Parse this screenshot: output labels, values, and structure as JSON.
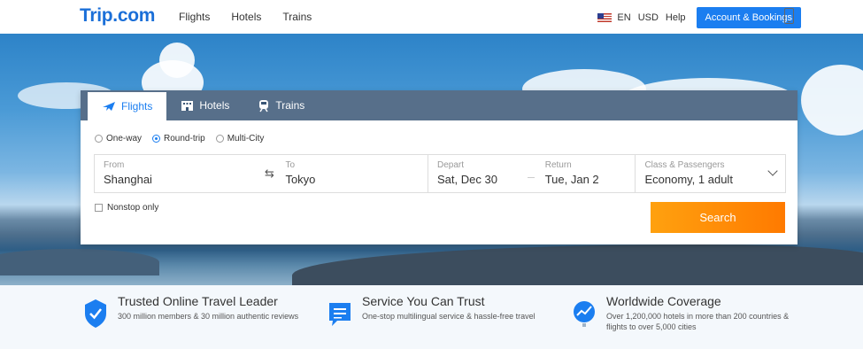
{
  "header": {
    "logo": "Trip.com",
    "nav": [
      "Flights",
      "Hotels",
      "Trains"
    ],
    "language": "EN",
    "currency": "USD",
    "help": "Help",
    "account_button": "Account & Bookings"
  },
  "search": {
    "tabs": [
      {
        "label": "Flights",
        "icon": "plane-icon",
        "active": true
      },
      {
        "label": "Hotels",
        "icon": "hotel-icon",
        "active": false
      },
      {
        "label": "Trains",
        "icon": "train-icon",
        "active": false
      }
    ],
    "trip_types": [
      {
        "label": "One-way",
        "selected": false
      },
      {
        "label": "Round-trip",
        "selected": true
      },
      {
        "label": "Multi-City",
        "selected": false
      }
    ],
    "from": {
      "label": "From",
      "value": "Shanghai"
    },
    "to": {
      "label": "To",
      "value": "Tokyo"
    },
    "depart": {
      "label": "Depart",
      "value": "Sat, Dec 30"
    },
    "return": {
      "label": "Return",
      "value": "Tue, Jan 2"
    },
    "class_passengers": {
      "label": "Class & Passengers",
      "value": "Economy, 1 adult"
    },
    "nonstop_label": "Nonstop only",
    "search_button": "Search"
  },
  "features": [
    {
      "icon": "shield-check-icon",
      "title": "Trusted Online Travel Leader",
      "desc": "300 million members & 30 million authentic reviews"
    },
    {
      "icon": "chat-bubble-icon",
      "title": "Service You Can Trust",
      "desc": "One-stop multilingual service & hassle-free travel"
    },
    {
      "icon": "globe-plane-icon",
      "title": "Worldwide Coverage",
      "desc": "Over 1,200,000 hotels in more than 200 countries & flights to over 5,000 cities"
    }
  ],
  "colors": {
    "brand": "#1b6fd8",
    "accent": "#ff8a00",
    "tab_bar": "#284669"
  }
}
